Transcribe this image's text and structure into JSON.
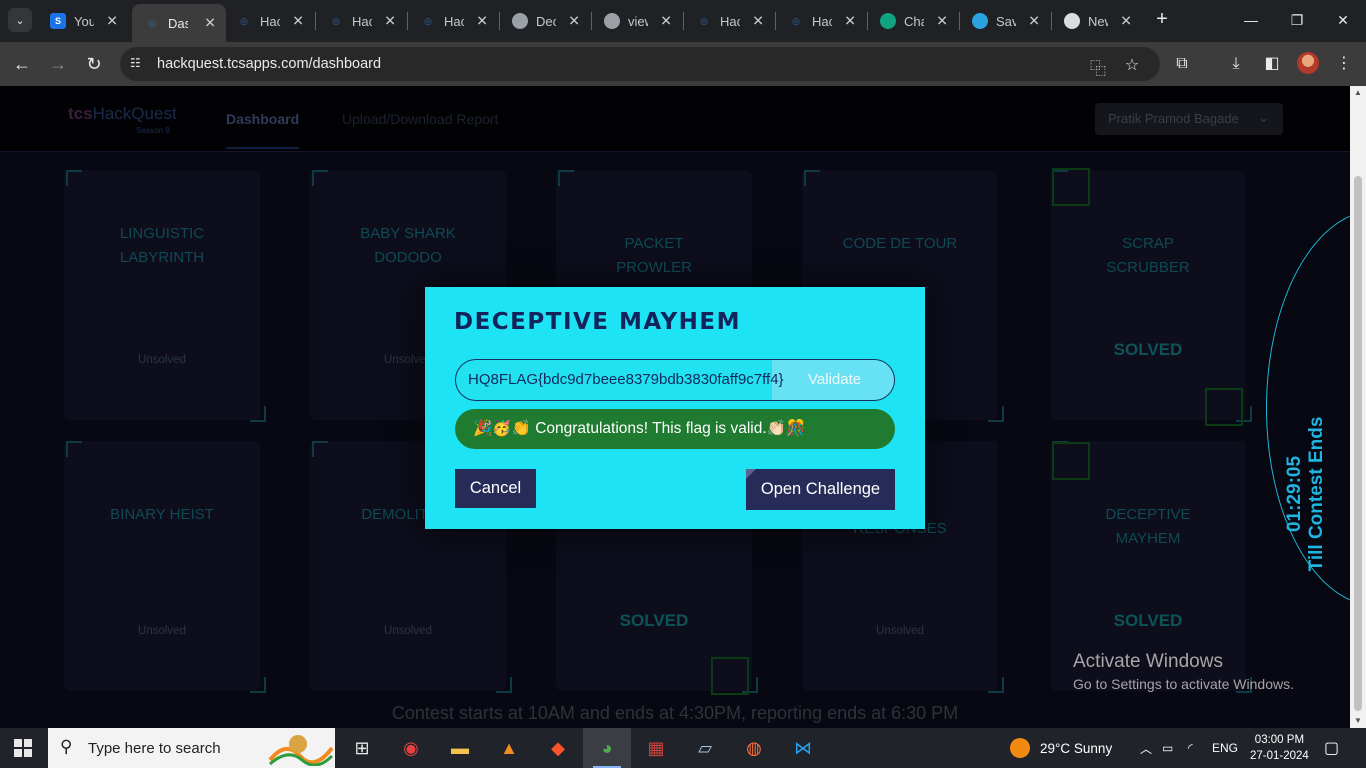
{
  "browser": {
    "tabs": [
      {
        "label": "You",
        "favicon": "S",
        "favicon_color": "#1b73e8"
      },
      {
        "label": "Dash",
        "favicon": "TATA",
        "favicon_color": "#2b6cb0",
        "active": true
      },
      {
        "label": "Hack",
        "favicon": "TATA",
        "favicon_color": "#2b6cb0"
      },
      {
        "label": "Hack",
        "favicon": "TATA",
        "favicon_color": "#2b6cb0"
      },
      {
        "label": "Hack",
        "favicon": "TATA",
        "favicon_color": "#2b6cb0"
      },
      {
        "label": "Dec",
        "favicon": "globe",
        "favicon_color": "#9aa0a6"
      },
      {
        "label": "view",
        "favicon": "globe",
        "favicon_color": "#9aa0a6"
      },
      {
        "label": "Hack",
        "favicon": "TATA",
        "favicon_color": "#2b6cb0"
      },
      {
        "label": "Hack",
        "favicon": "TATA",
        "favicon_color": "#2b6cb0"
      },
      {
        "label": "Cha",
        "favicon": "chatgpt",
        "favicon_color": "#10a37f"
      },
      {
        "label": "Save",
        "favicon": "telegram",
        "favicon_color": "#2aa3e0"
      },
      {
        "label": "New",
        "favicon": "chrome",
        "favicon_color": "#dadce0"
      }
    ],
    "url": "hackquest.tcsapps.com/dashboard"
  },
  "site": {
    "logo_brand": "tcs",
    "logo_name": "HackQuest",
    "logo_season": "Season 8",
    "nav": {
      "dashboard": "Dashboard",
      "upload": "Upload/Download Report"
    },
    "user_name": "Pratik Pramod Bagade"
  },
  "challenges": [
    {
      "title": "LINGUISTIC LABYRINTH",
      "status": "Unsolved"
    },
    {
      "title": "BABY SHARK DODODO",
      "status": "Unsolved"
    },
    {
      "title": "PACKET PROWLER",
      "status": ""
    },
    {
      "title": "CODE DE TOUR",
      "status": ""
    },
    {
      "title": "SCRAP SCRUBBER",
      "status": "SOLVED"
    },
    {
      "title": "BINARY HEIST",
      "status": "Unsolved"
    },
    {
      "title": "DEMOLITION",
      "status": "Unsolved"
    },
    {
      "title": "",
      "status": "SOLVED"
    },
    {
      "title": "RESPONSES",
      "status": "Unsolved"
    },
    {
      "title": "DECEPTIVE MAYHEM",
      "status": "SOLVED"
    }
  ],
  "timer": {
    "time": "01:29:05",
    "label": "Till Contest Ends"
  },
  "footer_note": "Contest starts at 10AM and ends at 4:30PM, reporting ends at 6:30 PM",
  "modal": {
    "title": "DECEPTIVE MAYHEM",
    "flag_value": "HQ8FLAG{bdc9d7beee8379bdb3830faff9c7ff4}",
    "validate_label": "Validate",
    "success_message": "🎉🥳👏 Congratulations! This flag is valid.👏🏻🎊",
    "cancel_label": "Cancel",
    "open_label": "Open Challenge"
  },
  "activate_windows": {
    "title": "Activate Windows",
    "subtitle": "Go to Settings to activate Windows."
  },
  "taskbar": {
    "search_placeholder": "Type here to search",
    "weather": "29°C  Sunny",
    "language": "ENG",
    "time": "03:00 PM",
    "date": "27-01-2024"
  }
}
